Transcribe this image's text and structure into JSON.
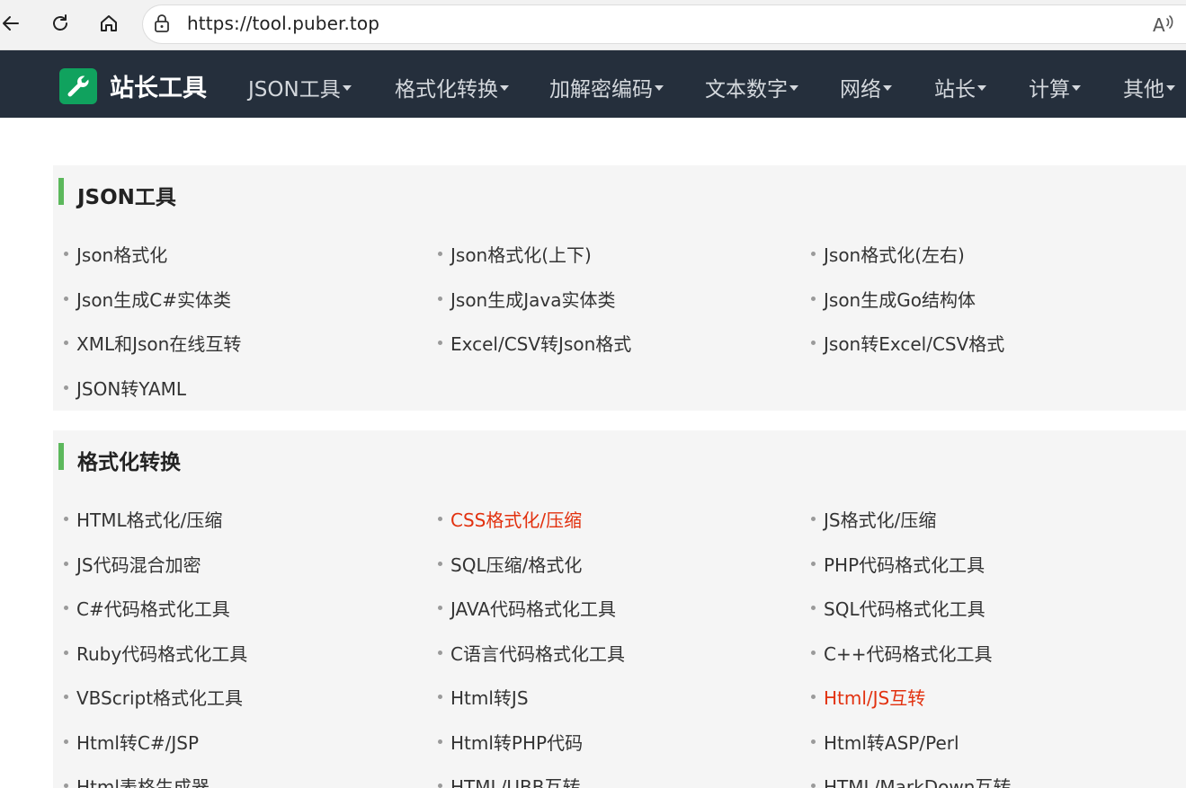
{
  "browser": {
    "url": "https://tool.puber.top"
  },
  "site": {
    "brand": "站长工具",
    "nav": [
      "JSON工具",
      "格式化转换",
      "加解密编码",
      "文本数字",
      "网络",
      "站长",
      "计算",
      "其他"
    ]
  },
  "sections": [
    {
      "title": "JSON工具",
      "items": [
        "Json格式化",
        " Json格式化(上下)",
        "Json格式化(左右)",
        "Json生成C#实体类",
        " Json生成Java实体类",
        "Json生成Go结构体",
        "XML和Json在线互转",
        "Excel/CSV转Json格式",
        "Json转Excel/CSV格式",
        "JSON转YAML"
      ]
    },
    {
      "title": "格式化转换",
      "items": [
        "HTML格式化/压缩",
        " CSS格式化/压缩",
        "JS格式化/压缩",
        " JS代码混合加密",
        "SQL压缩/格式化",
        "PHP代码格式化工具",
        "C#代码格式化工具",
        "JAVA代码格式化工具",
        "SQL代码格式化工具",
        "Ruby代码格式化工具",
        "C语言代码格式化工具",
        "C++代码格式化工具",
        "VBScript格式化工具",
        " Html转JS",
        "Html/JS互转",
        " Html转C#/JSP",
        "Html转PHP代码",
        "Html转ASP/Perl",
        "Html表格生成器",
        "HTML/UBB互转",
        "HTML/MarkDown互转"
      ],
      "highlighted": [
        1,
        14
      ]
    }
  ],
  "colors": {
    "nav_bg": "#252f3c",
    "logo_bg": "#10a25e",
    "section_bar": "#5cb85c",
    "highlight": "#e2310f"
  },
  "icons": [
    "back-arrow-icon",
    "refresh-icon",
    "home-icon",
    "lock-icon",
    "read-aloud-icon",
    "wrench-icon"
  ]
}
